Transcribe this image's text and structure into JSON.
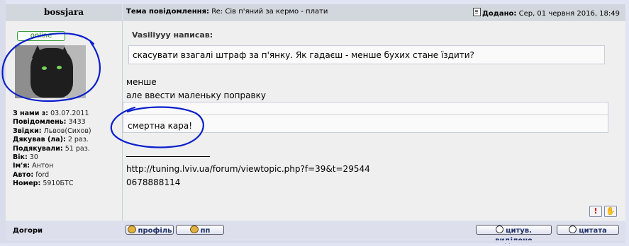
{
  "post": {
    "author": "bossjara",
    "status": "online",
    "subject_label": "Тема повідомлення:",
    "subject": "Re: Сів п'яний за кермо - плати",
    "posted_label": "Додано:",
    "posted": "Сер, 01 червня 2016, 18:49"
  },
  "profile": {
    "fields": [
      {
        "label": "З нами з:",
        "value": "03.07.2011"
      },
      {
        "label": "Повідомлень:",
        "value": "3433"
      },
      {
        "label": "Звідки:",
        "value": "Львов(Сихов)"
      },
      {
        "label": "Дякував (ла):",
        "value": "2 раз."
      },
      {
        "label": "Подякували:",
        "value": "51 раз."
      },
      {
        "label": "Вік:",
        "value": "30"
      },
      {
        "label": "Ім'я:",
        "value": "Антон"
      },
      {
        "label": "Авто:",
        "value": "ford"
      },
      {
        "label": "Номер:",
        "value": "5910БТС"
      }
    ]
  },
  "content": {
    "quote1_author": "Vasiliyyy написав:",
    "quote1_text": "скасувати взагалі штраф за п'янку. Як гадаєш - менше бухих стане їздити?",
    "reply_line1": "менше",
    "reply_line2": "але ввести маленьку поправку",
    "quote2_text": "смертна кара!",
    "signature_url": "http://tuning.lviv.ua/forum/viewtopic.php?f=39&t=29544",
    "signature_phone": "0678888114"
  },
  "footer": {
    "back_to_top": "Догори",
    "profile_button": "профіль",
    "pm_button": "пп",
    "quote_selected_button": "цитув. виділене",
    "quote_button": "цитата"
  },
  "icons": {
    "report": "exclamation-icon",
    "thanks": "hand-icon"
  },
  "colors": {
    "annotation": "#0A1FCC"
  }
}
